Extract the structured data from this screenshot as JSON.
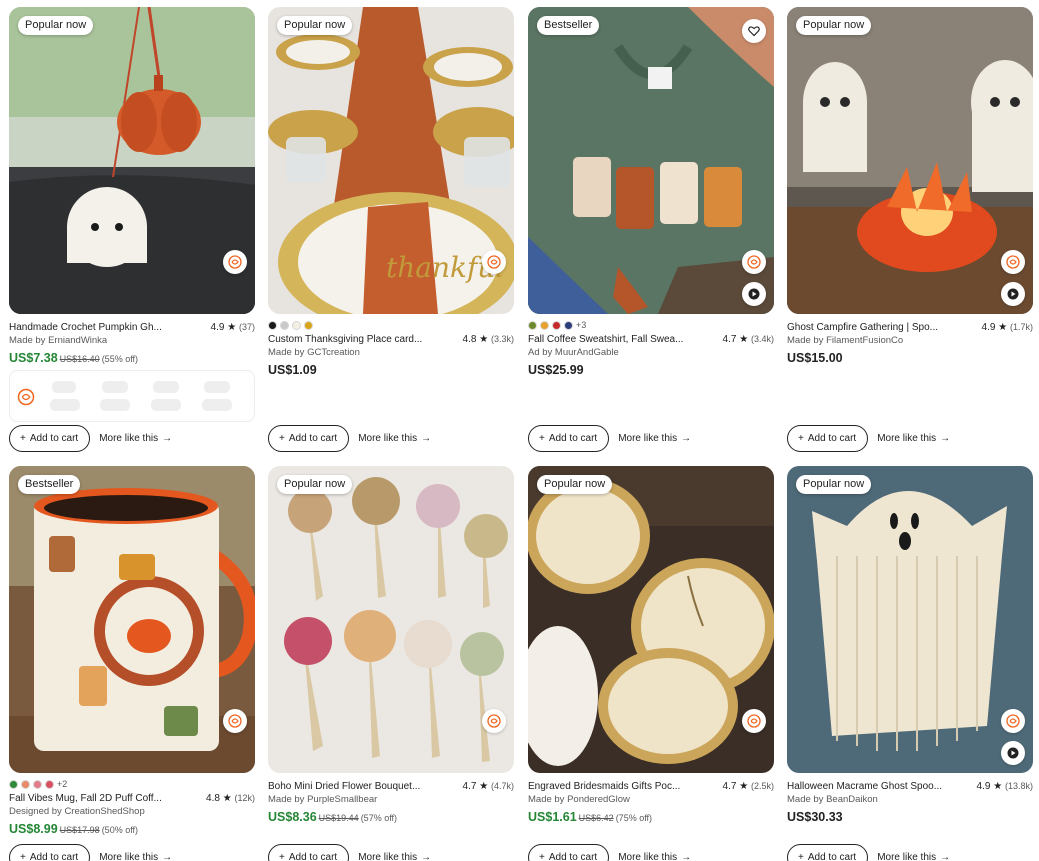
{
  "products": [
    {
      "badge": "Popular now",
      "title": "Handmade Crochet Pumpkin Gh...",
      "rating": "4.9",
      "count": "(37)",
      "seller": "Made by ErniandWinka",
      "price": "US$7.38",
      "orig": "US$16.40",
      "discount": "(55% off)",
      "sale": true,
      "swatches": [],
      "swatch_more": ""
    },
    {
      "badge": "Popular now",
      "title": "Custom Thanksgiving Place card...",
      "rating": "4.8",
      "count": "(3.3k)",
      "seller": "Made by GCTcreation",
      "price": "US$1.09",
      "orig": "",
      "discount": "",
      "sale": false,
      "swatches": [
        "#1a1a1a",
        "#c9c9c9",
        "#f3efe2",
        "#d8a61a"
      ],
      "swatch_more": ""
    },
    {
      "badge": "Bestseller",
      "title": "Fall Coffee Sweatshirt, Fall Swea...",
      "rating": "4.7",
      "count": "(3.4k)",
      "seller": "Ad by MuurAndGable",
      "price": "US$25.99",
      "orig": "",
      "discount": "",
      "sale": false,
      "swatches": [
        "#6d8a2a",
        "#e8a12c",
        "#c42a2a",
        "#2b3d7a"
      ],
      "swatch_more": "+3"
    },
    {
      "badge": "Popular now",
      "title": "Ghost Campfire Gathering | Spo...",
      "rating": "4.9",
      "count": "(1.7k)",
      "seller": "Made by FilamentFusionCo",
      "price": "US$15.00",
      "orig": "",
      "discount": "",
      "sale": false,
      "swatches": [],
      "swatch_more": ""
    },
    {
      "badge": "Bestseller",
      "title": "Fall Vibes Mug, Fall 2D Puff Coff...",
      "rating": "4.8",
      "count": "(12k)",
      "seller": "Designed by CreationShedShop",
      "price": "US$8.99",
      "orig": "US$17.98",
      "discount": "(50% off)",
      "sale": true,
      "swatches": [
        "#2f8a3a",
        "#e98a6a",
        "#e47b8a",
        "#d9505f"
      ],
      "swatch_more": "+2"
    },
    {
      "badge": "Popular now",
      "title": "Boho Mini Dried Flower Bouquet...",
      "rating": "4.7",
      "count": "(4.7k)",
      "seller": "Made by PurpleSmallbear",
      "price": "US$8.36",
      "orig": "US$19.44",
      "discount": "(57% off)",
      "sale": true,
      "swatches": [],
      "swatch_more": ""
    },
    {
      "badge": "Popular now",
      "title": "Engraved Bridesmaids Gifts Poc...",
      "rating": "4.7",
      "count": "(2.5k)",
      "seller": "Made by PonderedGlow",
      "price": "US$1.61",
      "orig": "US$6.42",
      "discount": "(75% off)",
      "sale": true,
      "swatches": [],
      "swatch_more": ""
    },
    {
      "badge": "Popular now",
      "title": "Halloween Macrame Ghost Spoo...",
      "rating": "4.9",
      "count": "(13.8k)",
      "seller": "Made by BeanDaikon",
      "price": "US$30.33",
      "orig": "",
      "discount": "",
      "sale": false,
      "swatches": [],
      "swatch_more": ""
    }
  ],
  "actions": {
    "add_to_cart": "Add to cart",
    "more_like_this": "More like this"
  },
  "colors": {
    "sale_price": "#258635",
    "brand_orange": "#f1641e"
  },
  "icons": {
    "star": "star-icon",
    "plus": "plus-icon",
    "arrow": "arrow-right-icon",
    "heart": "heart-icon",
    "play": "play-icon",
    "etsy": "etsy-bee-icon"
  }
}
